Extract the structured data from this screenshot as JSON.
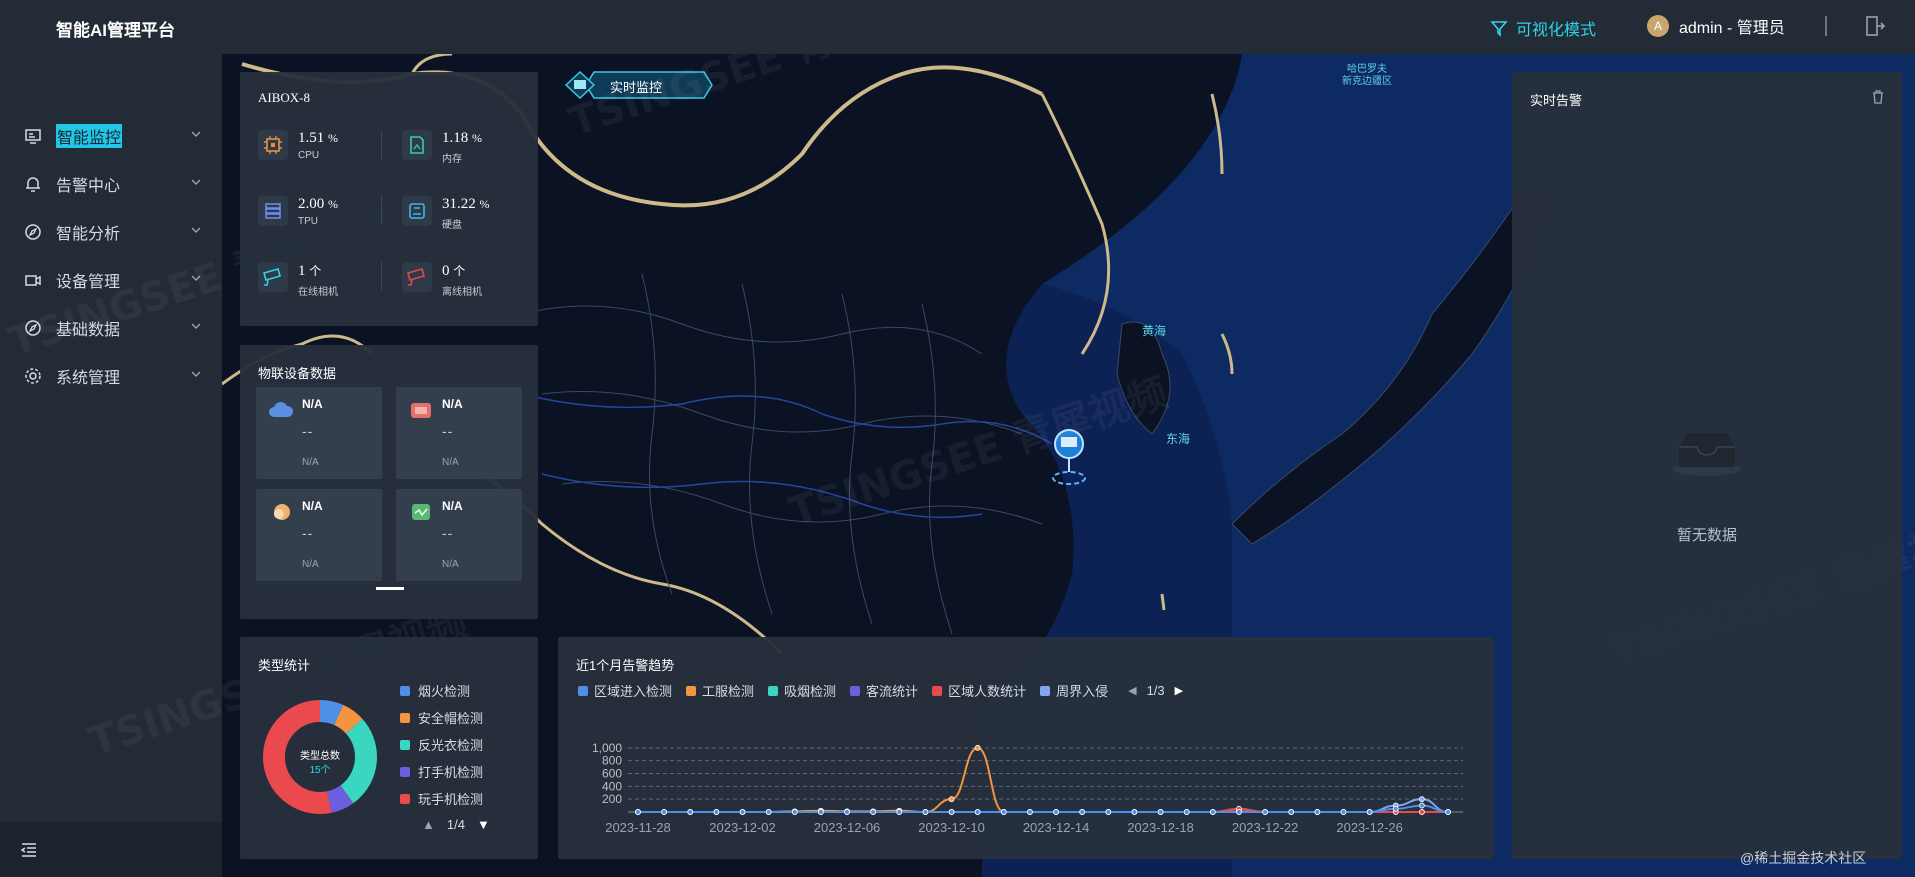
{
  "app": {
    "title": "智能AI管理平台"
  },
  "header": {
    "vis_mode": "可视化模式",
    "avatar_letter": "A",
    "user_label": "admin - 管理员"
  },
  "sidebar": {
    "items": [
      {
        "label": "智能监控",
        "icon": "monitor-icon",
        "active": true
      },
      {
        "label": "告警中心",
        "icon": "bell-icon"
      },
      {
        "label": "智能分析",
        "icon": "compass-icon"
      },
      {
        "label": "设备管理",
        "icon": "camera-icon"
      },
      {
        "label": "基础数据",
        "icon": "compass-icon"
      },
      {
        "label": "系统管理",
        "icon": "gear-icon"
      }
    ]
  },
  "map": {
    "badge": "实时监控",
    "labels": {
      "yellow_sea": "黄海",
      "east_sea": "东海",
      "region_top": "哈巴罗夫\n新克边疆区"
    }
  },
  "device": {
    "title": "AIBOX-8",
    "stats": [
      {
        "value": "1.51",
        "unit": "%",
        "label": "CPU",
        "color": "#e8913a"
      },
      {
        "value": "1.18",
        "unit": "%",
        "label": "内存",
        "color": "#3dc9a4"
      },
      {
        "value": "2.00",
        "unit": "%",
        "label": "TPU",
        "color": "#6f8cf2"
      },
      {
        "value": "31.22",
        "unit": "%",
        "label": "硬盘",
        "color": "#3fb7e6"
      },
      {
        "value": "1",
        "unit": "个",
        "label": "在线相机",
        "color": "#2fd3e6"
      },
      {
        "value": "0",
        "unit": "个",
        "label": "离线相机",
        "color": "#e5484d"
      }
    ]
  },
  "iot": {
    "title": "物联设备数据",
    "cards": [
      {
        "name": "N/A",
        "value": "--",
        "sub": "N/A",
        "color": "#5b8fe3"
      },
      {
        "name": "N/A",
        "value": "--",
        "sub": "N/A",
        "color": "#e3706a"
      },
      {
        "name": "N/A",
        "value": "--",
        "sub": "N/A",
        "color": "#f0b070"
      },
      {
        "name": "N/A",
        "value": "--",
        "sub": "N/A",
        "color": "#5cb870"
      }
    ]
  },
  "type_stats": {
    "title": "类型统计",
    "center_title": "类型总数",
    "center_value": "15个",
    "legend": [
      {
        "label": "烟火检测",
        "color": "#4e8fe8"
      },
      {
        "label": "安全帽检测",
        "color": "#f2953e"
      },
      {
        "label": "反光衣检测",
        "color": "#3ad6c0"
      },
      {
        "label": "打手机检测",
        "color": "#6b5fe0"
      },
      {
        "label": "玩手机检测",
        "color": "#ea4a4e"
      }
    ],
    "page": "1/4"
  },
  "trend": {
    "title": "近1个月告警趋势",
    "legend": [
      {
        "label": "区域进入检测",
        "color": "#4e8fe8"
      },
      {
        "label": "工服检测",
        "color": "#f2953e"
      },
      {
        "label": "吸烟检测",
        "color": "#3ad6c0"
      },
      {
        "label": "客流统计",
        "color": "#6b5fe0"
      },
      {
        "label": "区域人数统计",
        "color": "#ea4a4e"
      },
      {
        "label": "周界入侵",
        "color": "#7fa6ee"
      }
    ],
    "page": "1/3"
  },
  "alerts": {
    "title": "实时告警",
    "empty_text": "暂无数据"
  },
  "chart_data": [
    {
      "type": "pie",
      "title": "类型统计",
      "categories": [
        "烟火检测",
        "安全帽检测",
        "反光衣检测",
        "打手机检测",
        "玩手机检测"
      ],
      "values": [
        1,
        1,
        4,
        1,
        8
      ]
    },
    {
      "type": "line",
      "title": "近1个月告警趋势",
      "x": [
        "2023-11-28",
        "2023-11-29",
        "2023-11-30",
        "2023-12-01",
        "2023-12-02",
        "2023-12-03",
        "2023-12-04",
        "2023-12-05",
        "2023-12-06",
        "2023-12-07",
        "2023-12-08",
        "2023-12-09",
        "2023-12-10",
        "2023-12-11",
        "2023-12-12",
        "2023-12-13",
        "2023-12-14",
        "2023-12-15",
        "2023-12-16",
        "2023-12-17",
        "2023-12-18",
        "2023-12-19",
        "2023-12-20",
        "2023-12-21",
        "2023-12-22",
        "2023-12-23",
        "2023-12-24",
        "2023-12-25",
        "2023-12-26",
        "2023-12-27",
        "2023-12-28",
        "2023-12-29"
      ],
      "xticks": [
        "2023-11-28",
        "2023-12-02",
        "2023-12-06",
        "2023-12-10",
        "2023-12-14",
        "2023-12-18",
        "2023-12-22",
        "2023-12-26"
      ],
      "yticks": [
        200,
        400,
        600,
        800,
        1000
      ],
      "ytick_labels": [
        "200",
        "400",
        "600",
        "800",
        "1,000"
      ],
      "ylim": [
        0,
        1200
      ],
      "series": [
        {
          "name": "工服检测",
          "values": [
            0,
            0,
            0,
            0,
            0,
            0,
            10,
            20,
            10,
            10,
            20,
            0,
            200,
            1000,
            0,
            0,
            0,
            0,
            0,
            0,
            0,
            0,
            0,
            10,
            0,
            0,
            0,
            0,
            0,
            0,
            0,
            0
          ]
        },
        {
          "name": "区域人数统计",
          "values": [
            0,
            0,
            0,
            0,
            0,
            0,
            0,
            0,
            0,
            0,
            0,
            0,
            0,
            0,
            0,
            0,
            0,
            0,
            0,
            0,
            0,
            0,
            0,
            50,
            0,
            0,
            0,
            0,
            0,
            0,
            0,
            0
          ]
        },
        {
          "name": "周界入侵",
          "values": [
            0,
            0,
            0,
            0,
            0,
            0,
            0,
            0,
            0,
            0,
            0,
            0,
            0,
            0,
            0,
            0,
            0,
            0,
            0,
            0,
            0,
            0,
            0,
            0,
            0,
            0,
            0,
            0,
            0,
            100,
            200,
            0
          ]
        },
        {
          "name": "区域进入检测",
          "values": [
            0,
            0,
            0,
            0,
            0,
            0,
            0,
            0,
            0,
            0,
            0,
            0,
            0,
            0,
            0,
            0,
            0,
            0,
            0,
            0,
            0,
            0,
            0,
            0,
            0,
            0,
            0,
            0,
            0,
            50,
            100,
            0
          ]
        }
      ]
    }
  ]
}
